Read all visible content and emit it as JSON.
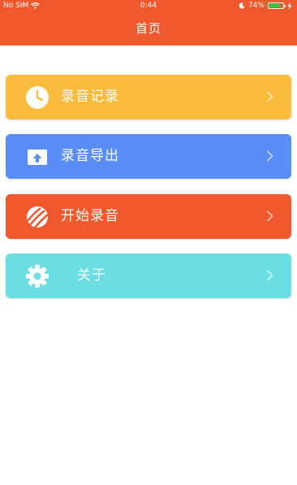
{
  "status_bar": {
    "carrier": "No SIM",
    "time": "0:44",
    "battery_percent": "74%"
  },
  "nav": {
    "title": "首页"
  },
  "menu": [
    {
      "label": "录音记录",
      "color": "#fbbb3c",
      "icon": "clock-icon"
    },
    {
      "label": "录音导出",
      "color": "#5a8ef6",
      "icon": "upload-icon"
    },
    {
      "label": "开始录音",
      "color": "#f0582d",
      "icon": "record-icon"
    },
    {
      "label": "关于",
      "color": "#6cdde3",
      "icon": "gear-icon"
    }
  ]
}
